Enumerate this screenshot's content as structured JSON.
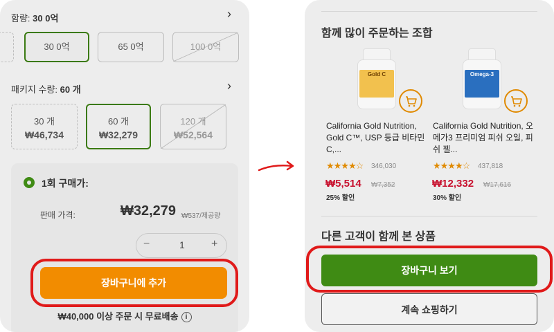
{
  "left": {
    "content_title": "함량:",
    "content_value": "30 0억",
    "content_options": [
      "30 0억",
      "65 0억",
      "100 0억"
    ],
    "package_title": "패키지 수량:",
    "package_value": "60 개",
    "package_options": [
      {
        "label": "30 개",
        "price": "₩46,734"
      },
      {
        "label": "60 개",
        "price": "₩32,279"
      },
      {
        "label": "120 개",
        "price": "₩52,564"
      }
    ],
    "purchase_type": "1회 구매가:",
    "price_label": "판매 가격:",
    "price": "₩32,279",
    "unit_price": "₩537/제공량",
    "quantity": "1",
    "add_to_cart": "장바구니에 추가",
    "free_shipping": "₩40,000 이상 주문 시 무료배송"
  },
  "right": {
    "section_title": "함께 많이 주문하는 조합",
    "products": [
      {
        "name": "California Gold Nutrition, Gold C™, USP 등급 비타민C,...",
        "label": "Gold C",
        "label_color": "#f2c14e",
        "rating_count": "346,030",
        "sale_price": "₩5,514",
        "original_price": "₩7,352",
        "discount": "25% 할인"
      },
      {
        "name": "California Gold Nutrition, 오메가3 프리미엄 피쉬 오일, 피쉬 젤...",
        "label": "Omega-3",
        "label_color": "#2a6fbf",
        "rating_count": "437,818",
        "sale_price": "₩12,332",
        "original_price": "₩17,616",
        "discount": "30% 할인"
      }
    ],
    "section2_title": "다른 고객이 함께 본 상품",
    "view_cart": "장바구니 보기",
    "continue_shopping": "계속 쇼핑하기"
  },
  "colors": {
    "green": "#3f8b14",
    "orange": "#f28c00",
    "highlight": "#e01a1a",
    "sale_red": "#c8102e"
  }
}
